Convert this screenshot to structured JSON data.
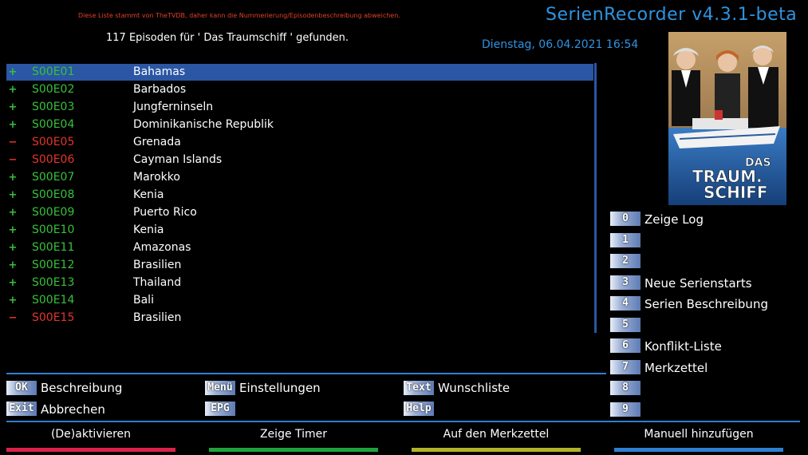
{
  "header": {
    "notice": "Diese Liste stammt von TheTVDB, daher kann die Nummerierung/Episodenbeschreibung abweichen.",
    "app_title": "SerienRecorder v4.3.1-beta",
    "found_text": "117 Episoden für ' Das Traumschiff ' gefunden.",
    "datetime": "Dienstag, 06.04.2021   16:54"
  },
  "cover": {
    "logo_text_1": "DAS",
    "logo_text_2": "TRAUM.",
    "logo_text_3": "SCHIFF"
  },
  "episodes": [
    {
      "sign": "+",
      "status": "active",
      "code": "S00E01",
      "title": "Bahamas",
      "selected": true
    },
    {
      "sign": "+",
      "status": "active",
      "code": "S00E02",
      "title": "Barbados"
    },
    {
      "sign": "+",
      "status": "active",
      "code": "S00E03",
      "title": "Jungferninseln"
    },
    {
      "sign": "+",
      "status": "active",
      "code": "S00E04",
      "title": "Dominikanische Republik"
    },
    {
      "sign": "−",
      "status": "inactive",
      "code": "S00E05",
      "title": "Grenada"
    },
    {
      "sign": "−",
      "status": "inactive",
      "code": "S00E06",
      "title": "Cayman Islands"
    },
    {
      "sign": "+",
      "status": "active",
      "code": "S00E07",
      "title": "Marokko"
    },
    {
      "sign": "+",
      "status": "active",
      "code": "S00E08",
      "title": "Kenia"
    },
    {
      "sign": "+",
      "status": "active",
      "code": "S00E09",
      "title": "Puerto Rico"
    },
    {
      "sign": "+",
      "status": "active",
      "code": "S00E10",
      "title": "Kenia"
    },
    {
      "sign": "+",
      "status": "active",
      "code": "S00E11",
      "title": "Amazonas"
    },
    {
      "sign": "+",
      "status": "active",
      "code": "S00E12",
      "title": "Brasilien"
    },
    {
      "sign": "+",
      "status": "active",
      "code": "S00E13",
      "title": "Thailand"
    },
    {
      "sign": "+",
      "status": "active",
      "code": "S00E14",
      "title": "Bali"
    },
    {
      "sign": "−",
      "status": "inactive",
      "code": "S00E15",
      "title": "Brasilien"
    }
  ],
  "number_keys": [
    {
      "key": "0",
      "label": "Zeige Log"
    },
    {
      "key": "1",
      "label": ""
    },
    {
      "key": "2",
      "label": ""
    },
    {
      "key": "3",
      "label": "Neue Serienstarts"
    },
    {
      "key": "4",
      "label": "Serien Beschreibung"
    },
    {
      "key": "5",
      "label": ""
    },
    {
      "key": "6",
      "label": "Konflikt-Liste"
    },
    {
      "key": "7",
      "label": "Merkzettel"
    },
    {
      "key": "8",
      "label": ""
    },
    {
      "key": "9",
      "label": ""
    }
  ],
  "func_keys": [
    {
      "key": "OK",
      "label": "Beschreibung"
    },
    {
      "key": "Exit",
      "label": "Abbrechen"
    },
    {
      "key": "Menü",
      "label": "Einstellungen"
    },
    {
      "key": "EPG",
      "label": ""
    },
    {
      "key": "Text",
      "label": "Wunschliste"
    },
    {
      "key": "Help",
      "label": ""
    }
  ],
  "color_buttons": [
    {
      "label": "(De)aktivieren",
      "color": "#d9234a"
    },
    {
      "label": "Zeige Timer",
      "color": "#1fa33c"
    },
    {
      "label": "Auf den Merkzettel",
      "color": "#b3b326"
    },
    {
      "label": "Manuell hinzufügen",
      "color": "#2f7fd2"
    }
  ],
  "colors": {
    "accent": "#2f93e0",
    "selection": "#2b56a4",
    "active": "#36c23a",
    "inactive": "#e3352a"
  }
}
